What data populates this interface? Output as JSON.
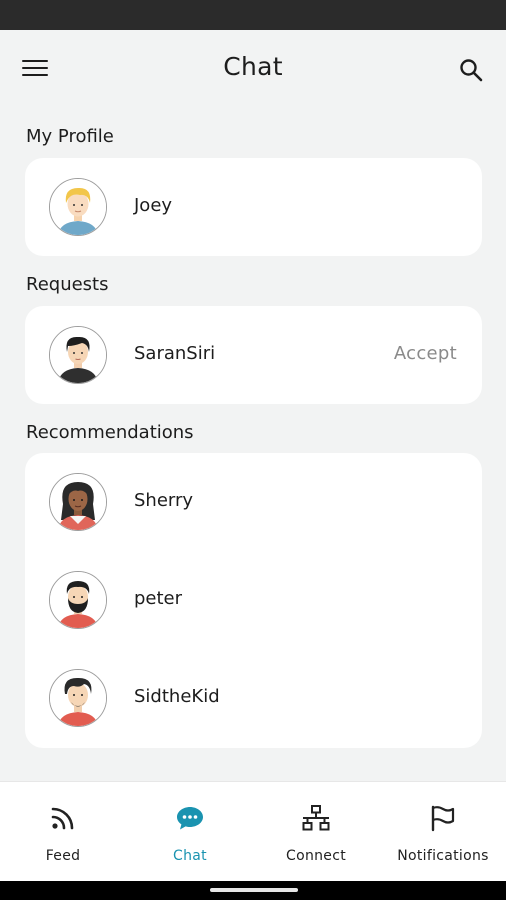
{
  "header": {
    "title": "Chat"
  },
  "sections": {
    "profile": {
      "label": "My Profile",
      "name": "Joey"
    },
    "requests": {
      "label": "Requests",
      "name": "SaranSiri",
      "action": "Accept"
    },
    "recommendations": {
      "label": "Recommendations",
      "items": [
        {
          "name": "Sherry"
        },
        {
          "name": "peter"
        },
        {
          "name": "SidtheKid"
        }
      ]
    }
  },
  "nav": {
    "items": [
      {
        "label": "Feed",
        "icon": "rss-icon"
      },
      {
        "label": "Chat",
        "icon": "chat-bubble-icon",
        "active": true
      },
      {
        "label": "Connect",
        "icon": "network-icon"
      },
      {
        "label": "Notifications",
        "icon": "flag-icon"
      }
    ],
    "accent": "#1a93b0"
  }
}
